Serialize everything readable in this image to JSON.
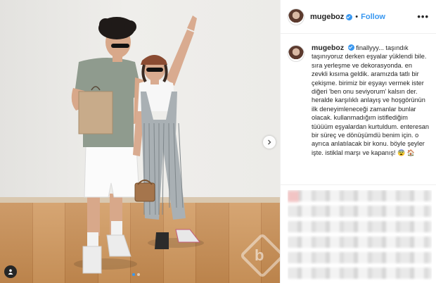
{
  "post": {
    "username": "mugeboz",
    "verified": true,
    "separator": "•",
    "follow_label": "Follow",
    "more_icon": "more-options-icon",
    "caption": "finallyyy... taşındık taşınıyoruz derken eşyalar yüklendi bile. sıra yerleşme ve dekorasyonda. en zevkli kısıma geldik. aramızda tatlı bir çekişme. birimiz bir eşyayı vermek ister diğeri 'ben onu seviyorum' kalsın der. heralde karşılıklı anlayış ve hoşgörünün ilk deneyimleneceği zamanlar bunlar olacak. kullanmadığım istiflediğim tüüüüm eşyalardan kurtuldum. enteresan bir süreç ve dönüşümdü benim için. o ayrıca anlatılacak bir konu. böyle şeyler işte. istiklal marşı ve kapanış!",
    "caption_emojis": "😨 🏠"
  },
  "photo": {
    "next_icon": "chevron-right-icon",
    "tag_icon": "user-tag-icon",
    "carousel_dots": 2,
    "active_dot": 0
  },
  "colors": {
    "accent": "#3897f0",
    "text": "#262626",
    "border": "#efefef"
  }
}
